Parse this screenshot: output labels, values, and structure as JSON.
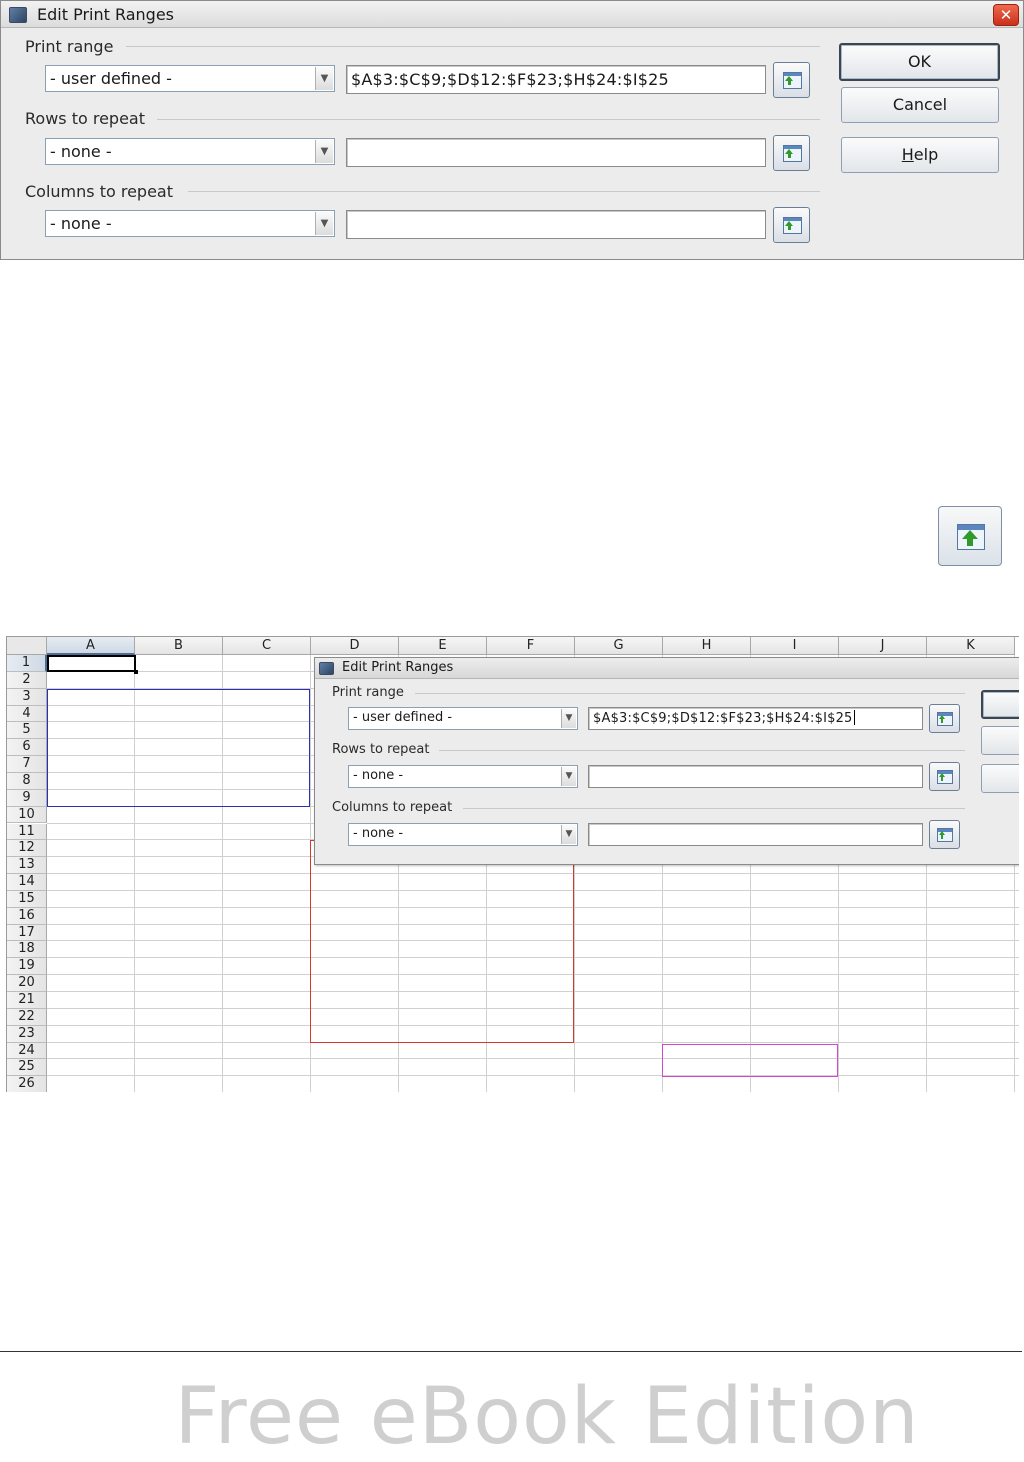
{
  "dialog": {
    "title": "Edit Print Ranges",
    "print_range": {
      "label": "Print range",
      "combo_value": "- user defined -",
      "field_value": "$A$3:$C$9;$D$12:$F$23;$H$24:$I$25"
    },
    "rows_to_repeat": {
      "label": "Rows to repeat",
      "combo_value": "- none -",
      "field_value": ""
    },
    "columns_to_repeat": {
      "label": "Columns to repeat",
      "combo_value": "- none -",
      "field_value": ""
    },
    "buttons": {
      "ok": "OK",
      "cancel": "Cancel",
      "help": "Help"
    }
  },
  "spreadsheet": {
    "columns": [
      "A",
      "B",
      "C",
      "D",
      "E",
      "F",
      "G",
      "H",
      "I",
      "J",
      "K"
    ],
    "rows": [
      "1",
      "2",
      "3",
      "4",
      "5",
      "6",
      "7",
      "8",
      "9",
      "10",
      "11",
      "12",
      "13",
      "14",
      "15",
      "16",
      "17",
      "18",
      "19",
      "20",
      "21",
      "22",
      "23",
      "24",
      "25",
      "26"
    ],
    "selected_column": "A",
    "selected_row": "1",
    "print_ranges": [
      "$A$3:$C$9",
      "$D$12:$F$23",
      "$H$24:$I$25"
    ],
    "overlay_dialog": {
      "title": "Edit Print Ranges",
      "print_range_label": "Print range",
      "print_range_combo": "- user defined -",
      "print_range_field": "$A$3:$C$9;$D$12:$F$23;$H$24:$I$25",
      "rows_label": "Rows to repeat",
      "rows_combo": "- none -",
      "columns_label": "Columns to repeat",
      "columns_combo": "- none -"
    }
  },
  "footer": {
    "watermark": "Free eBook Edition"
  },
  "icons": {
    "shrink": "shrink-dialog-icon",
    "app": "app-icon",
    "close": "close-icon",
    "dropdown": "chevron-down-icon"
  },
  "colors": {
    "range_1": "#2a2fb8",
    "range_2": "#d23a2e",
    "range_3": "#d447d4"
  }
}
